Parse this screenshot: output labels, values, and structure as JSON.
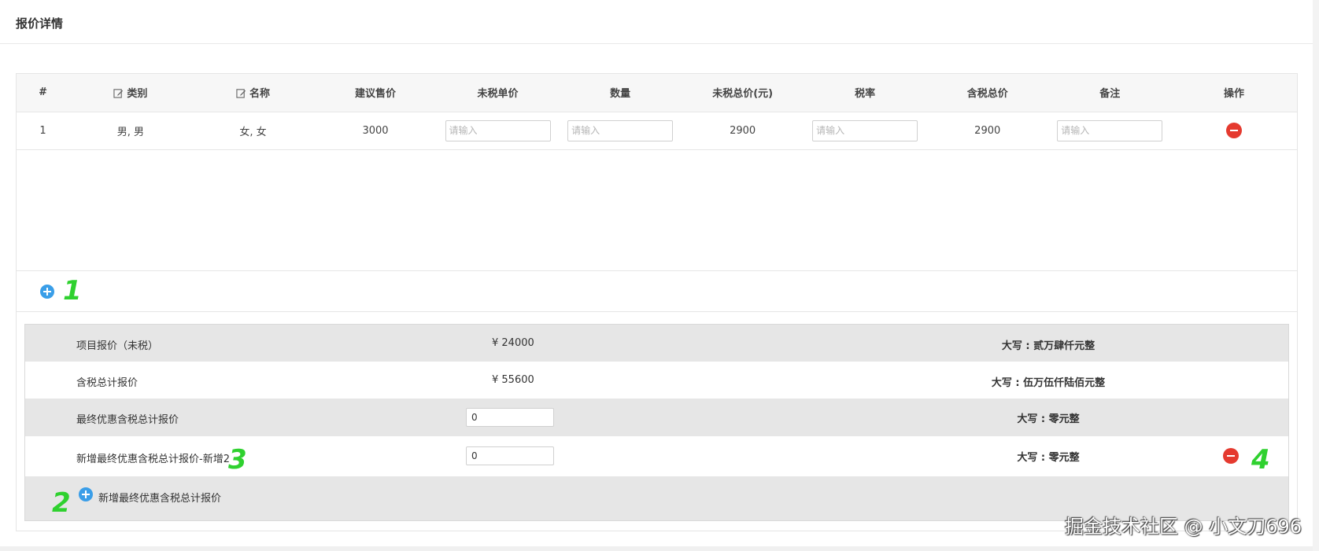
{
  "header": {
    "title": "报价详情"
  },
  "table": {
    "columns": [
      {
        "label": "#",
        "editable": false
      },
      {
        "label": "类别",
        "editable": true
      },
      {
        "label": "名称",
        "editable": true
      },
      {
        "label": "建议售价",
        "editable": false
      },
      {
        "label": "未税单价",
        "editable": false
      },
      {
        "label": "数量",
        "editable": false
      },
      {
        "label": "未税总价(元)",
        "editable": false
      },
      {
        "label": "税率",
        "editable": false
      },
      {
        "label": "含税总价",
        "editable": false
      },
      {
        "label": "备注",
        "editable": false
      },
      {
        "label": "操作",
        "editable": false
      }
    ],
    "rows": [
      {
        "index": "1",
        "category": "男, 男",
        "name": "女, 女",
        "suggested_price": "3000",
        "unit_price_placeholder": "请输入",
        "quantity_placeholder": "请输入",
        "total_untaxed": "2900",
        "tax_rate_placeholder": "请输入",
        "total_taxed": "2900",
        "remark_placeholder": "请输入"
      }
    ]
  },
  "summary": {
    "project_quote": {
      "label": "项目报价（未税）",
      "value": "¥ 24000",
      "daxie": "大写 : 贰万肆仟元整"
    },
    "taxed_total": {
      "label": "含税总计报价",
      "value": "¥ 55600",
      "daxie": "大写 : 伍万伍仟陆佰元整"
    },
    "final_discount": {
      "label": "最终优惠含税总计报价",
      "input_value": "0",
      "daxie": "大写 : 零元整"
    },
    "added_discount": {
      "label": "新增最终优惠含税总计报价-新增2",
      "input_value": "0",
      "daxie": "大写 : 零元整"
    },
    "add_label": "新增最终优惠含税总计报价"
  },
  "annotations": {
    "a1": "1",
    "a2": "2",
    "a3": "3",
    "a4": "4"
  },
  "watermark": "掘金技术社区 @ 小文刀696",
  "colors": {
    "remove": "#e53a2f",
    "add": "#3a9ee8",
    "annotation": "#2fd12f"
  }
}
